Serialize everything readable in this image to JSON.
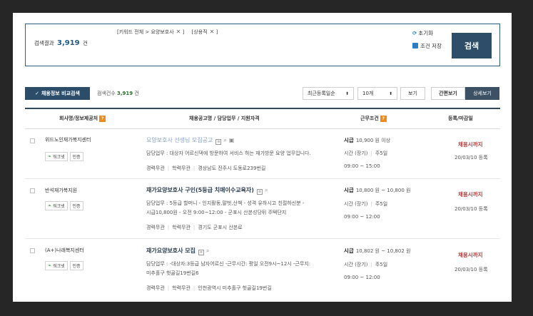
{
  "search": {
    "filters": [
      "[키워드 전체 > 요양보호사",
      "[상용직"
    ],
    "result_label": "검색결과",
    "result_count": "3,919",
    "result_unit": "건",
    "reset_label": "초기화",
    "save_label": "조건 저장",
    "search_button": "검색"
  },
  "toolbar": {
    "compare_label": "채용정보 비교검색",
    "count_label": "검색건수",
    "count_value": "3,919",
    "count_unit": "건",
    "sort_value": "최근등록일순",
    "size_value": "10개",
    "view_button": "보기",
    "simple_view": "간편보기",
    "detail_view": "상세보기"
  },
  "table": {
    "headers": {
      "company": "회사명/정보제공처",
      "title": "채용공고명 / 담당업무 / 지원자격",
      "conditions": "근무조건",
      "deadline": "등록/마감일"
    },
    "rows": [
      {
        "company": "위드노인재가복지센터",
        "badge1": "워크넷",
        "badge2": "인증",
        "title": "요양보호사 선생님 모집공고",
        "desc": "담당업무 : 대상자 어르신댁에 방문하여 서비스 하는 재가방문 요양 업무입니다.",
        "career": "경력무관",
        "education": "학력무관",
        "location": "경상남도 진주시 도동로239번길",
        "wage_label": "시급",
        "wage": "10,900 원 이상",
        "hours": "시간 (장기)",
        "days": "주5일",
        "time": "09:00 ~ 15:00",
        "deadline": "채용시까지",
        "registered": "20/03/10 등록"
      },
      {
        "company": "반석재가복지원",
        "badge1": "워크넷",
        "badge2": "인증",
        "title": "재가요양보호사 구인(5등급 치매이수교육자)",
        "desc1": "담당업무 : 5등급 할머니 - 인지활동,말벗,산책 - 성격 유하시고 친절하신분 -",
        "desc2": "시급10,800원 - 오전 9:00~12:00 - 군포시 산본성당뒤 주택단지",
        "career": "경력무관",
        "education": "학력무관",
        "location": "경기도 군포시 산본로",
        "wage_label": "시급",
        "wage": "10,800 원 ~ 10,800 원",
        "hours": "시간 (장기)",
        "days": "주5일",
        "time": "09:00 ~ 12:00",
        "deadline": "채용시까지",
        "registered": "20/03/10 등록"
      },
      {
        "company": "(A+)나래복지센터",
        "badge1": "워크넷",
        "badge2": "인증",
        "title": "재가요양보호사 모집",
        "desc1": "담당업무 : -대상자:3등급 남자어르신 -근무시간: 평일 오전9시~12시 -근무지:",
        "desc2": "미추홀구 헛골길19번길6",
        "career": "경력무관",
        "education": "학력무관",
        "location": "인천광역시 미추홀구 헛골길19번길",
        "wage_label": "시급",
        "wage": "10,802 원 ~ 10,802 원",
        "hours": "시간 (장기)",
        "days": "주5일",
        "time": "09:00 ~ 12:00",
        "deadline": "채용시까지",
        "registered": "20/03/10 등록"
      }
    ]
  },
  "colors": {
    "primary": "#2d4d68",
    "deadline": "#b43a3a",
    "accent": "#f08a1d",
    "count_number": "#1d5a8e"
  }
}
